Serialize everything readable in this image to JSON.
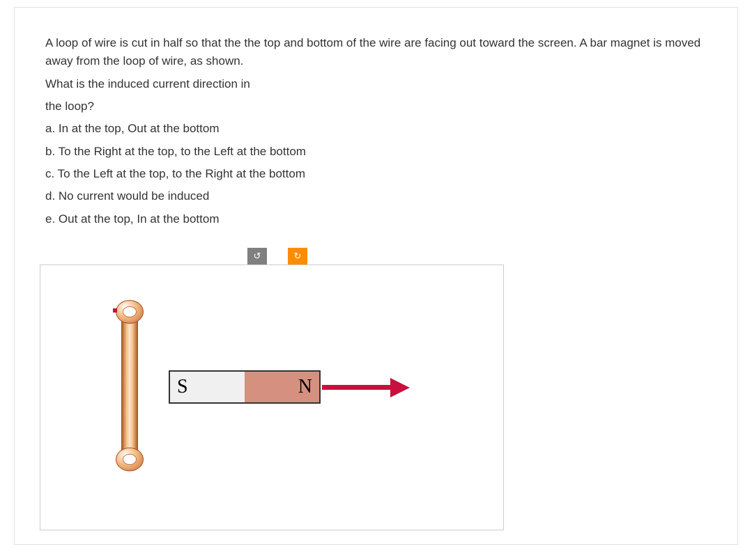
{
  "question": {
    "intro": "A loop of wire is cut in half so that the the top and bottom of the wire are facing out toward the screen. A bar magnet is moved away from the loop of wire, as shown.",
    "prompt_line1": "What is the induced current direction in",
    "prompt_line2": "the loop?",
    "option_a": "a. In at the top, Out at the bottom",
    "option_b": "b. To the Right at the top, to the Left at the bottom",
    "option_c": "c. To the Left at the top, to the Right at the bottom",
    "option_d": "d. No current would be induced",
    "option_e": "e. Out at the top, In at the bottom"
  },
  "toolbar": {
    "rotate_ccw": "↺",
    "rotate_cw": "↻"
  },
  "diagram": {
    "magnet_s_label": "S",
    "magnet_n_label": "N"
  }
}
